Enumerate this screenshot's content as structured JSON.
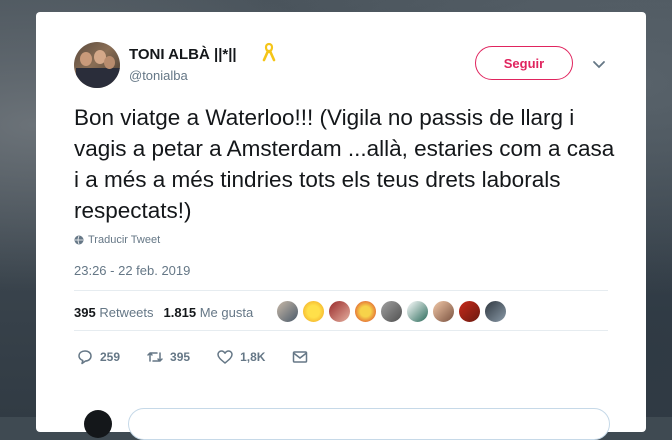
{
  "tweet": {
    "author_name": "TONI ALBÀ ||*||",
    "handle": "@tonialba",
    "follow_label": "Seguir",
    "text": "Bon viatge a Waterloo!!! (Vigila no passis de llarg i vagis a petar a Amsterdam ...allà, estaries com a casa i a més a més tindries tots els teus drets laborals respectats!)",
    "translate_label": "Traducir Tweet",
    "timestamp": "23:26 - 22 feb. 2019"
  },
  "stats": {
    "retweets_count": "395",
    "retweets_label": "Retweets",
    "likes_count": "1.815",
    "likes_label": "Me gusta"
  },
  "actions": {
    "reply_count": "259",
    "retweet_count": "395",
    "like_count": "1,8K"
  },
  "icons": [
    "ribbon-icon",
    "chevron-down-icon",
    "globe-icon",
    "reply-icon",
    "retweet-icon",
    "heart-icon",
    "message-icon"
  ],
  "colors": {
    "follow": "#e0245e",
    "secondary_text": "#657786",
    "primary_text": "#14171a",
    "ribbon": "#f5c518"
  }
}
